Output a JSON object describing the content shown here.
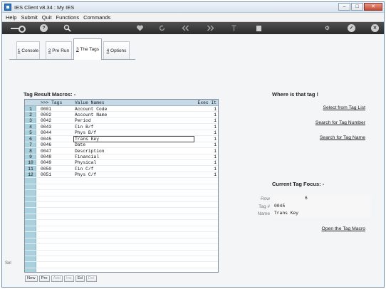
{
  "window": {
    "title": "IES Client v8.34 : My IES",
    "controls": [
      "–",
      "□",
      "✕"
    ]
  },
  "menu": [
    "Help",
    "Submit",
    "Quit",
    "Functions",
    "Commands"
  ],
  "toolbar": {
    "icons": [
      "key-icon",
      "help-icon",
      "search-icon",
      "heart-icon",
      "refresh-icon",
      "rewind-icon",
      "fast-forward-icon",
      "upload-icon",
      "stop-icon",
      "settings-icon",
      "check-icon",
      "close-icon"
    ],
    "help_glyph": "?",
    "settings_glyph": "⚙",
    "check_glyph": "✓",
    "close_glyph": "✕"
  },
  "tabs": [
    {
      "num": "1",
      "label": "Console"
    },
    {
      "num": "2",
      "label": "Pre Run"
    },
    {
      "num": "3",
      "label": "The Tags",
      "active": true
    },
    {
      "num": "4",
      "label": "Options"
    }
  ],
  "macros": {
    "title": "Tag Result Macros: -",
    "headers": {
      "tags": ">>> Tags",
      "value_names": "Value Names",
      "exec": "Exec It"
    },
    "rows": [
      {
        "n": "1",
        "tag": "0001",
        "name": "Account Code",
        "exec": "1"
      },
      {
        "n": "2",
        "tag": "0002",
        "name": "Account Name",
        "exec": "1"
      },
      {
        "n": "3",
        "tag": "0042",
        "name": "Period",
        "exec": "1"
      },
      {
        "n": "4",
        "tag": "0043",
        "name": "Fin B/f",
        "exec": "1"
      },
      {
        "n": "5",
        "tag": "0044",
        "name": "Phys B/f",
        "exec": "1"
      },
      {
        "n": "6",
        "tag": "0045",
        "name": "Trans Key",
        "exec": "1",
        "selected": true
      },
      {
        "n": "7",
        "tag": "0046",
        "name": "Date",
        "exec": "1"
      },
      {
        "n": "8",
        "tag": "0047",
        "name": "Description",
        "exec": "1"
      },
      {
        "n": "9",
        "tag": "0048",
        "name": "Financial",
        "exec": "1"
      },
      {
        "n": "10",
        "tag": "0049",
        "name": "Physical",
        "exec": "1"
      },
      {
        "n": "11",
        "tag": "0050",
        "name": "Fin C/f",
        "exec": "1"
      },
      {
        "n": "12",
        "tag": "0051",
        "name": "Phys C/f",
        "exec": "1"
      }
    ],
    "nav": [
      {
        "label": "New",
        "enabled": true
      },
      {
        "label": "Pre",
        "enabled": true
      },
      {
        "label": "Add",
        "enabled": false
      },
      {
        "label": "Ins",
        "enabled": false
      },
      {
        "label": "Ed",
        "enabled": true
      },
      {
        "label": "Del",
        "enabled": false
      }
    ],
    "side_label": "Sel"
  },
  "where": {
    "title": "Where is that tag !",
    "links": [
      "Select from Tag List",
      "Search for Tag Number",
      "Search for Tag Name"
    ]
  },
  "focus": {
    "title": "Current Tag Focus: -",
    "row_label": "Row",
    "row_value": "6",
    "tag_label": "Tag #",
    "tag_value": "0045",
    "name_label": "Name",
    "name_value": "Trans Key",
    "open_link": "Open the Tag Macro"
  }
}
